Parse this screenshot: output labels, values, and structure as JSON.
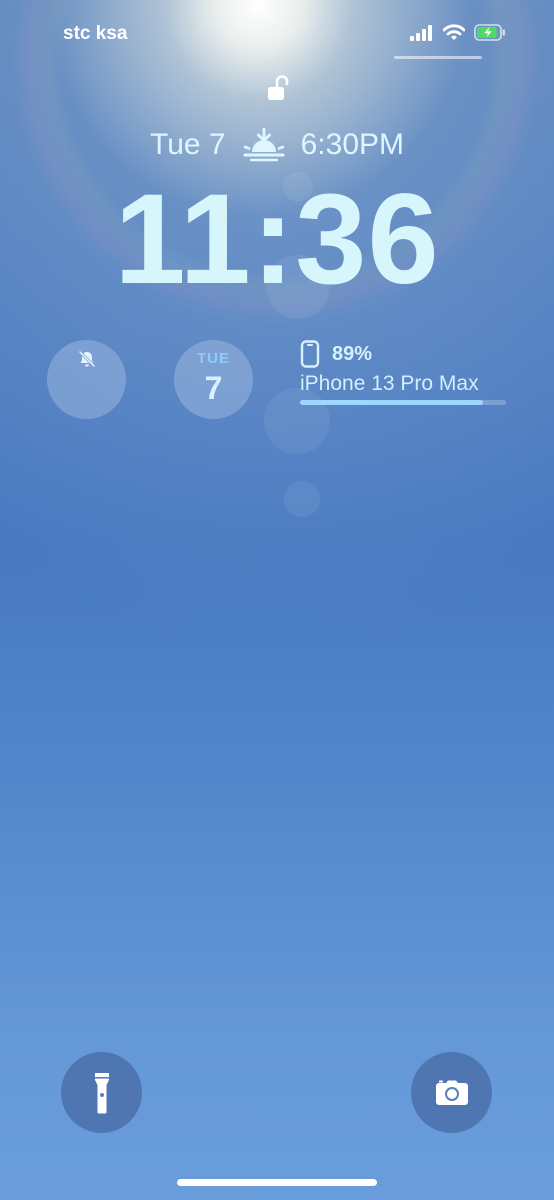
{
  "status_bar": {
    "carrier": "stc ksa",
    "signal_bars": 4,
    "wifi": true,
    "battery_charging": true,
    "battery_level": 0.89
  },
  "lock_state": "unlocked",
  "date_line": {
    "date": "Tue 7",
    "sun_icon": "sunset-icon",
    "event_time": "6:30PM"
  },
  "clock": "11:36",
  "widgets": {
    "silent_mode_icon": "bell-slash-icon",
    "calendar": {
      "weekday": "TUE",
      "day": "7"
    },
    "battery": {
      "percent_text": "89%",
      "percent_value": 0.89,
      "device_name": "iPhone 13 Pro Max",
      "icon": "iphone-icon"
    }
  },
  "quick_actions": {
    "flashlight_icon": "flashlight-icon",
    "camera_icon": "camera-icon"
  },
  "colors": {
    "widget_accent": "#9fd6ff",
    "battery_fill": "#4cd964"
  }
}
